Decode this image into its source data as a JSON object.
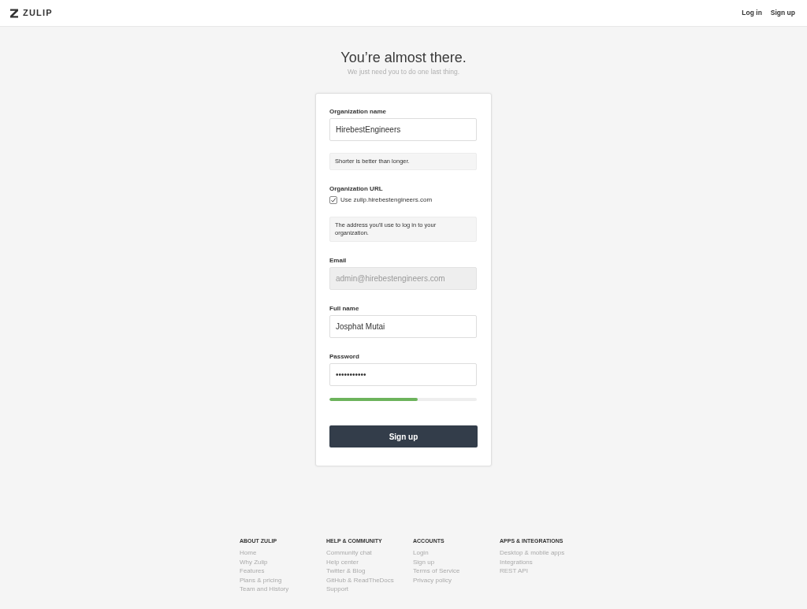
{
  "header": {
    "logo": "ZULIP",
    "nav": [
      "Log in",
      "Sign up"
    ]
  },
  "heading": {
    "title": "You’re almost there.",
    "subtitle": "We just need you to do one last thing."
  },
  "form": {
    "fields": [
      {
        "kind": "text",
        "label": "Organization name",
        "value": "HirebestEngineers",
        "disabled": false,
        "help": "Shorter is better than longer."
      },
      {
        "kind": "checkbox",
        "label": "Organization URL",
        "option": "Use zulip.hirebestengineers.com",
        "checked": true,
        "help": "The address you'll use to log in to your organization."
      },
      {
        "kind": "text",
        "label": "Email",
        "value": "admin@hirebestengineers.com",
        "disabled": true
      },
      {
        "kind": "text",
        "label": "Full name",
        "value": "Josphat Mutai",
        "disabled": false
      },
      {
        "kind": "password",
        "label": "Password",
        "value": "•••••••••••",
        "disabled": false,
        "strength": {
          "level": 0.6
        }
      }
    ],
    "submit": "Sign up"
  },
  "footer": {
    "columns": [
      {
        "heading": "ABOUT ZULIP",
        "links": [
          "Home",
          "Why Zulip",
          "Features",
          "Plans & pricing",
          "Team and History"
        ]
      },
      {
        "heading": "HELP & COMMUNITY",
        "links": [
          "Community chat",
          "Help center",
          "Twitter & Blog",
          "GitHub & ReadTheDocs",
          "Support"
        ]
      },
      {
        "heading": "ACCOUNTS",
        "links": [
          "Login",
          "Sign up",
          "Terms of Service",
          "Privacy policy"
        ]
      },
      {
        "heading": "APPS & INTEGRATIONS",
        "links": [
          "Desktop & mobile apps",
          "Integrations",
          "REST API"
        ]
      }
    ]
  }
}
